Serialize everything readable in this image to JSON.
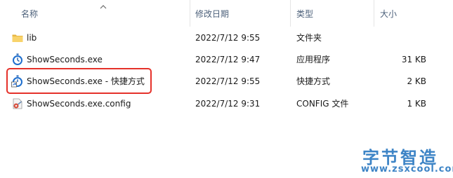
{
  "columns": {
    "name": "名称",
    "modified": "修改日期",
    "type": "类型",
    "size": "大小"
  },
  "sort": {
    "column": "name",
    "direction": "ascending"
  },
  "files": [
    {
      "icon": "folder-icon",
      "name": "lib",
      "modified": "2022/7/12 9:55",
      "type": "文件夹",
      "size": ""
    },
    {
      "icon": "stopwatch-exe-icon",
      "name": "ShowSeconds.exe",
      "modified": "2022/7/12 9:47",
      "type": "应用程序",
      "size": "31 KB"
    },
    {
      "icon": "shortcut-icon",
      "name": "ShowSeconds.exe - 快捷方式",
      "modified": "2022/7/12 9:55",
      "type": "快捷方式",
      "size": "2 KB",
      "highlighted": true
    },
    {
      "icon": "config-file-icon",
      "name": "ShowSeconds.exe.config",
      "modified": "2022/7/12 9:31",
      "type": "CONFIG 文件",
      "size": "1 KB"
    }
  ],
  "watermark": {
    "title": "字节智造",
    "url": "www.zsxcool.com"
  },
  "colors": {
    "highlight_border": "#e5312a",
    "header_text": "#4c607a",
    "watermark": "#3d84c6"
  }
}
